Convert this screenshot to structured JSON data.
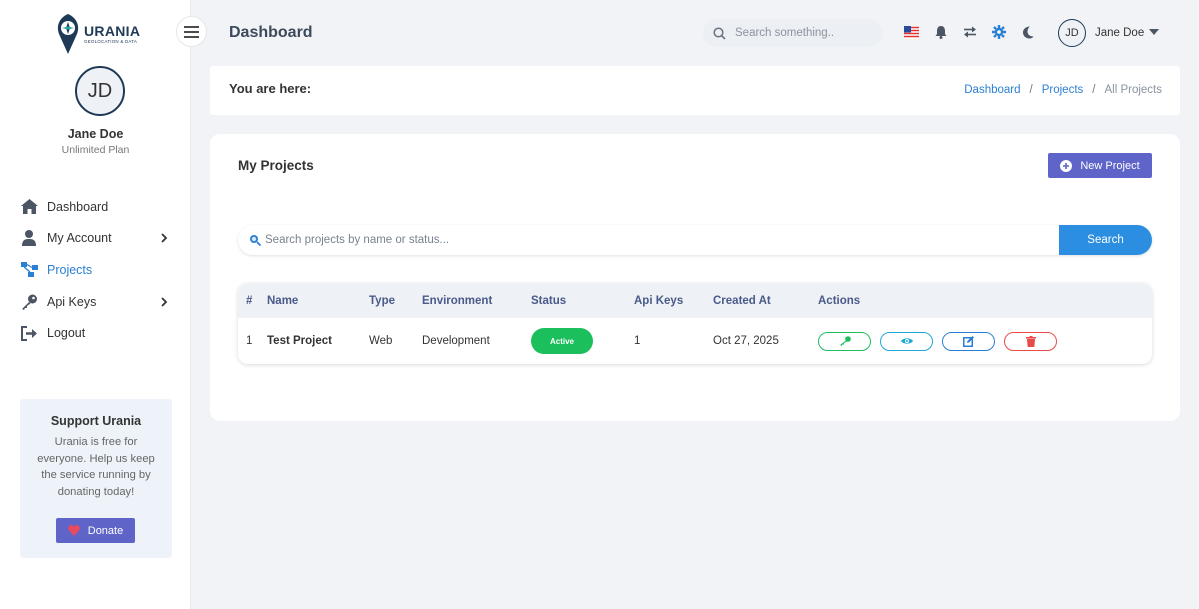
{
  "app": {
    "logo_name": "URANIA",
    "logo_tagline": "GEOLOCATION & DATA"
  },
  "user": {
    "initials": "JD",
    "name": "Jane Doe",
    "plan": "Unlimited Plan"
  },
  "sidebar": {
    "items": [
      {
        "label": "Dashboard",
        "icon": "home-icon"
      },
      {
        "label": "My Account",
        "icon": "user-icon"
      },
      {
        "label": "Projects",
        "icon": "projects-icon"
      },
      {
        "label": "Api Keys",
        "icon": "key-icon"
      },
      {
        "label": "Logout",
        "icon": "logout-icon"
      }
    ],
    "active": "Projects"
  },
  "support": {
    "title": "Support Urania",
    "text": "Urania is free for everyone. Help us keep the service running by donating today!",
    "donate_label": "Donate"
  },
  "header": {
    "title": "Dashboard",
    "search_placeholder": "Search something..",
    "user_name": "Jane Doe"
  },
  "breadcrumb": {
    "label": "You are here:",
    "items": [
      "Dashboard",
      "Projects",
      "All Projects"
    ]
  },
  "projects": {
    "title": "My Projects",
    "new_button": "New Project",
    "search_placeholder": "Search projects by name or status...",
    "search_button": "Search",
    "columns": [
      "#",
      "Name",
      "Type",
      "Environment",
      "Status",
      "Api Keys",
      "Created At",
      "Actions"
    ],
    "rows": [
      {
        "idx": "1",
        "name": "Test Project",
        "type": "Web",
        "environment": "Development",
        "status": "Active",
        "api_keys": "1",
        "created_at": "Oct 27, 2025"
      }
    ]
  },
  "colors": {
    "accent": "#2b7fd3",
    "primary_button": "#5f64c8",
    "status_active": "#1bbf5c",
    "danger": "#e84a4a"
  }
}
